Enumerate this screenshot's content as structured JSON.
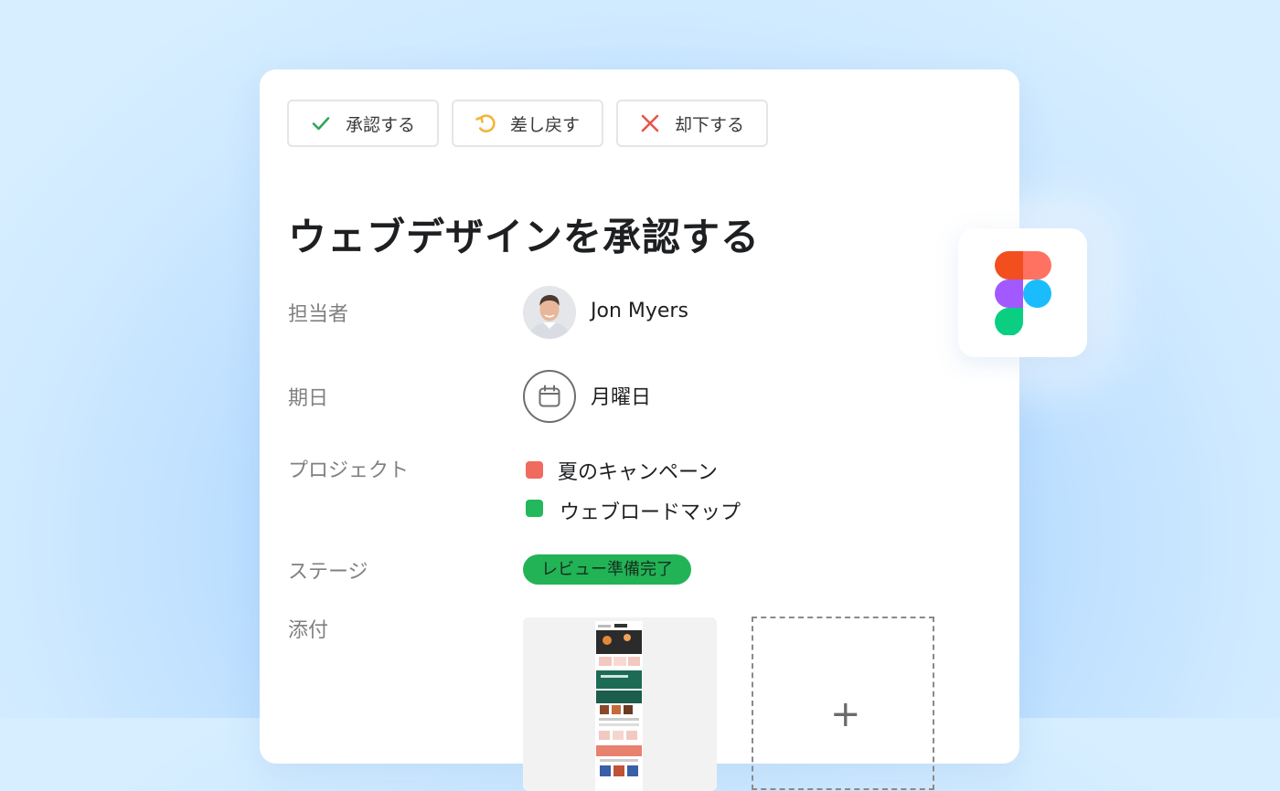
{
  "actions": {
    "approve_label": "承認する",
    "return_label": "差し戻す",
    "reject_label": "却下する"
  },
  "task": {
    "title": "ウェブデザインを承認する"
  },
  "fields": {
    "assignee": {
      "label": "担当者",
      "value": "Jon Myers"
    },
    "due_date": {
      "label": "期日",
      "value": "月曜日"
    },
    "projects": {
      "label": "プロジェクト",
      "items": [
        {
          "name": "夏のキャンペーン",
          "color": "#f06a5e"
        },
        {
          "name": "ウェブロードマップ",
          "color": "#23b85c"
        }
      ]
    },
    "stage": {
      "label": "ステージ",
      "value": "レビュー準備完了",
      "color": "#22b356"
    },
    "attachments": {
      "label": "添付",
      "add_symbol": "+"
    }
  },
  "icons": {
    "approve": "checkmark-icon",
    "return": "return-arrow-icon",
    "reject": "close-x-icon",
    "calendar": "calendar-icon",
    "app": "figma-logo-icon"
  },
  "colors": {
    "approve": "#2ea65a",
    "return": "#f2b53a",
    "reject": "#e8554b"
  }
}
